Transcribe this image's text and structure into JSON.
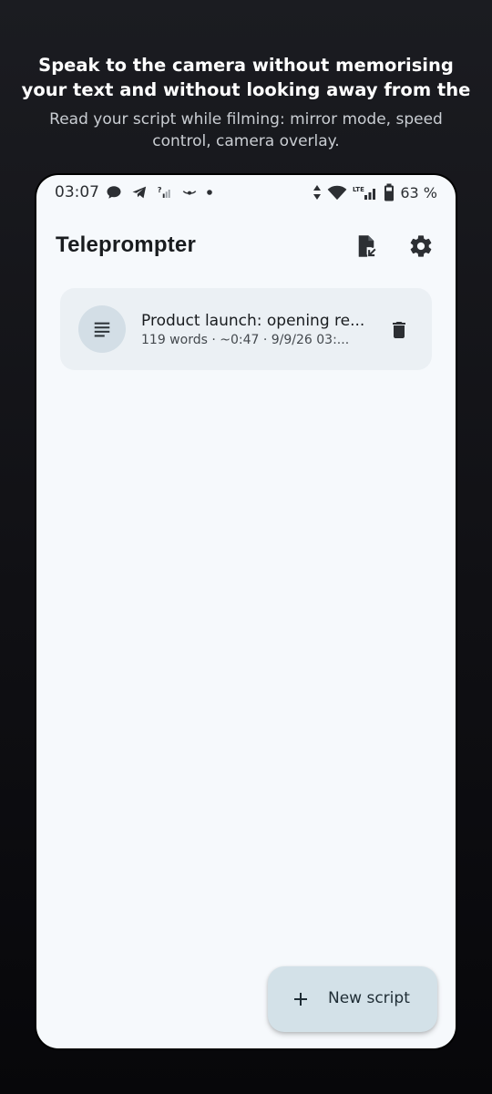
{
  "promo": {
    "title_line1": "Speak to the camera without memorising",
    "title_line2": "your text and without looking away from the",
    "subtitle": "Read your script while filming: mirror mode, speed control, camera overlay."
  },
  "status_bar": {
    "time": "03:07",
    "battery_percent": "63 %",
    "left_icons": [
      "chat-bubble-icon",
      "telegram-icon",
      "no-sim-signal-icon",
      "eye-icon",
      "dot-icon"
    ],
    "right_icons": [
      "data-arrows-icon",
      "wifi-icon",
      "lte-signal-icon",
      "battery-icon"
    ],
    "lte_label": "LTE"
  },
  "app_bar": {
    "title": "Teleprompter",
    "actions": [
      "import-file-icon",
      "gear-icon"
    ]
  },
  "scripts": [
    {
      "title": "Product launch: opening re...",
      "meta": "119 words · ~0:47 · 9/9/26 03:..."
    }
  ],
  "fab": {
    "label": "New script",
    "icon": "plus-icon"
  },
  "colors": {
    "screen_bg": "#f6f9fc",
    "card_bg": "#ebf0f4",
    "avatar_bg": "#d3dee6",
    "fab_bg": "#d3e1e8",
    "text_primary": "#191c1f",
    "text_secondary": "#44494e"
  }
}
